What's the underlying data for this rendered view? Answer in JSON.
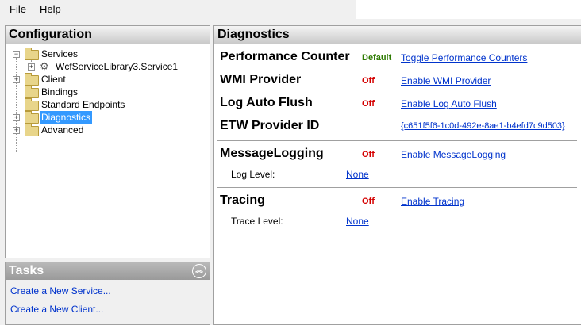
{
  "menu": {
    "file": "File",
    "help": "Help"
  },
  "configuration": {
    "title": "Configuration",
    "tree": {
      "services": "Services",
      "service1": "WcfServiceLibrary3.Service1",
      "client": "Client",
      "bindings": "Bindings",
      "standard_endpoints": "Standard Endpoints",
      "diagnostics": "Diagnostics",
      "advanced": "Advanced"
    }
  },
  "tasks": {
    "title": "Tasks",
    "items": [
      "Create a New Service...",
      "Create a New Client..."
    ]
  },
  "diagnostics": {
    "title": "Diagnostics",
    "performance_counter": {
      "label": "Performance Counter",
      "status": "Default",
      "link": "Toggle Performance Counters"
    },
    "wmi_provider": {
      "label": "WMI Provider",
      "status": "Off",
      "link": "Enable WMI Provider"
    },
    "log_auto_flush": {
      "label": "Log Auto Flush",
      "status": "Off",
      "link": "Enable Log Auto Flush"
    },
    "etw_provider": {
      "label": "ETW Provider ID",
      "link": "{c651f5f6-1c0d-492e-8ae1-b4efd7c9d503}"
    },
    "message_logging": {
      "label": "MessageLogging",
      "status": "Off",
      "link": "Enable MessageLogging",
      "sub_label": "Log Level:",
      "sub_value": "None"
    },
    "tracing": {
      "label": "Tracing",
      "status": "Off",
      "link": "Enable Tracing",
      "sub_label": "Trace Level:",
      "sub_value": "None"
    }
  },
  "colors": {
    "selection": "#3399ff",
    "link": "#0033cc",
    "status_off": "#d40000",
    "status_default": "#2d7a00"
  }
}
